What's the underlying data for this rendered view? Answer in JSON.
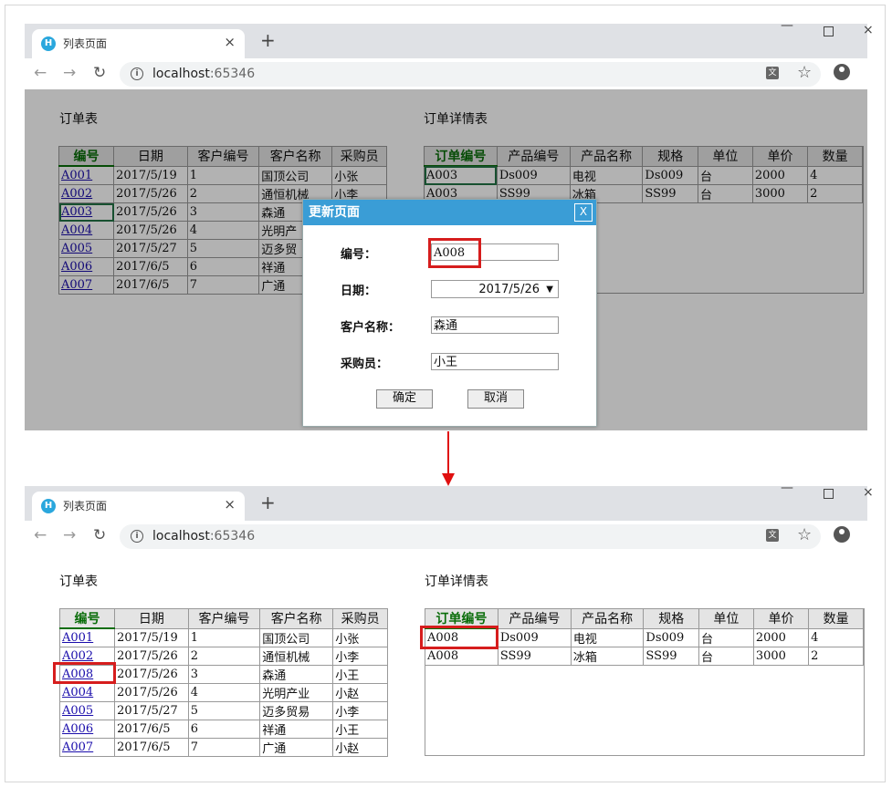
{
  "browser": {
    "tab_title": "列表页面",
    "tab_close": "×",
    "new_tab": "+",
    "url_host": "localhost",
    "url_port": ":65346",
    "logo_letter": "H"
  },
  "orders": {
    "title": "订单表",
    "columns": [
      "编号",
      "日期",
      "客户编号",
      "客户名称",
      "采购员"
    ],
    "rows_before": [
      [
        "A001",
        "2017/5/19",
        "1",
        "国顶公司",
        "小张"
      ],
      [
        "A002",
        "2017/5/26",
        "2",
        "通恒机械",
        "小李"
      ],
      [
        "A003",
        "2017/5/26",
        "3",
        "森通",
        ""
      ],
      [
        "A004",
        "2017/5/26",
        "4",
        "光明产",
        ""
      ],
      [
        "A005",
        "2017/5/27",
        "5",
        "迈多贸",
        ""
      ],
      [
        "A006",
        "2017/6/5",
        "6",
        "祥通",
        ""
      ],
      [
        "A007",
        "2017/6/5",
        "7",
        "广通",
        ""
      ]
    ],
    "rows_after": [
      [
        "A001",
        "2017/5/19",
        "1",
        "国顶公司",
        "小张"
      ],
      [
        "A002",
        "2017/5/26",
        "2",
        "通恒机械",
        "小李"
      ],
      [
        "A008",
        "2017/5/26",
        "3",
        "森通",
        "小王"
      ],
      [
        "A004",
        "2017/5/26",
        "4",
        "光明产业",
        "小赵"
      ],
      [
        "A005",
        "2017/5/27",
        "5",
        "迈多贸易",
        "小李"
      ],
      [
        "A006",
        "2017/6/5",
        "6",
        "祥通",
        "小王"
      ],
      [
        "A007",
        "2017/6/5",
        "7",
        "广通",
        "小赵"
      ]
    ]
  },
  "details": {
    "title": "订单详情表",
    "columns": [
      "订单编号",
      "产品编号",
      "产品名称",
      "规格",
      "单位",
      "单价",
      "数量"
    ],
    "rows_before": [
      [
        "A003",
        "Ds009",
        "电视",
        "Ds009",
        "台",
        "2000",
        "4"
      ],
      [
        "A003",
        "SS99",
        "冰箱",
        "SS99",
        "台",
        "3000",
        "2"
      ]
    ],
    "rows_after": [
      [
        "A008",
        "Ds009",
        "电视",
        "Ds009",
        "台",
        "2000",
        "4"
      ],
      [
        "A008",
        "SS99",
        "冰箱",
        "SS99",
        "台",
        "3000",
        "2"
      ]
    ]
  },
  "dialog": {
    "title": "更新页面",
    "close": "X",
    "id_label": "编号：",
    "id_value": "A008",
    "date_label": "日期：",
    "date_value": "2017/5/26",
    "customer_label": "客户名称：",
    "customer_value": "森通",
    "buyer_label": "采购员：",
    "buyer_value": "小王",
    "ok_label": "确定",
    "cancel_label": "取消"
  },
  "colors": {
    "dialog_header": "#3a9dd6",
    "highlight_red": "#d61d1d",
    "arrow_red": "#e01010",
    "active_header_green": "#0a6d0a"
  }
}
